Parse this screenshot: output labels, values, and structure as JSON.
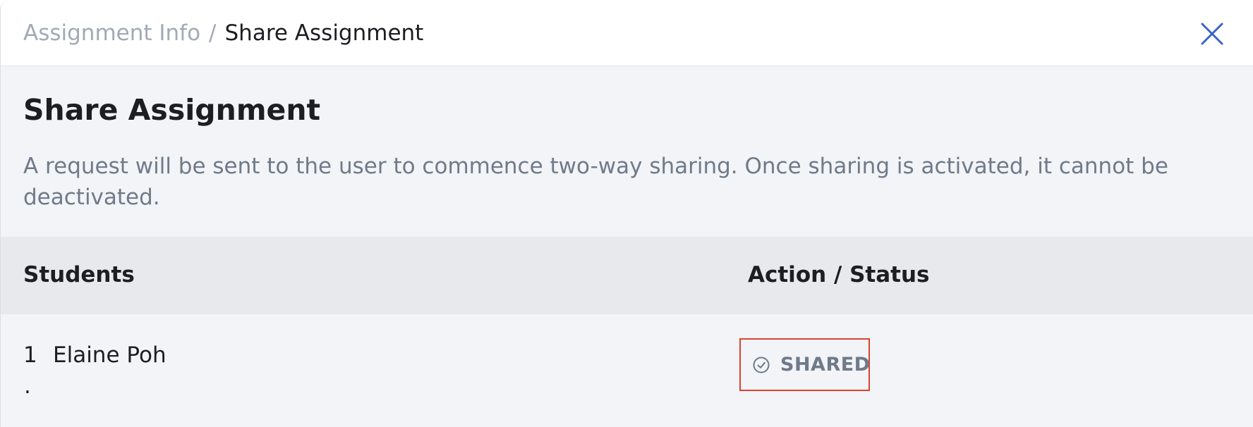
{
  "breadcrumb": {
    "parent": "Assignment Info",
    "separator": "/",
    "current": "Share Assignment"
  },
  "page": {
    "title": "Share Assignment",
    "description": "A request will be sent to the user to commence two-way sharing. Once sharing is activated, it cannot be deactivated."
  },
  "table": {
    "headers": {
      "students": "Students",
      "action_status": "Action / Status"
    },
    "rows": [
      {
        "number": "1",
        "name": "Elaine Poh",
        "extra": ".",
        "status": "SHARED",
        "status_icon": "check-circle-icon"
      }
    ]
  },
  "icons": {
    "close": "close-icon",
    "status": "check-circle-icon"
  },
  "colors": {
    "accent_blue": "#3b63c9",
    "highlight_border": "#d9432e",
    "muted_text": "#6f7a8a"
  }
}
